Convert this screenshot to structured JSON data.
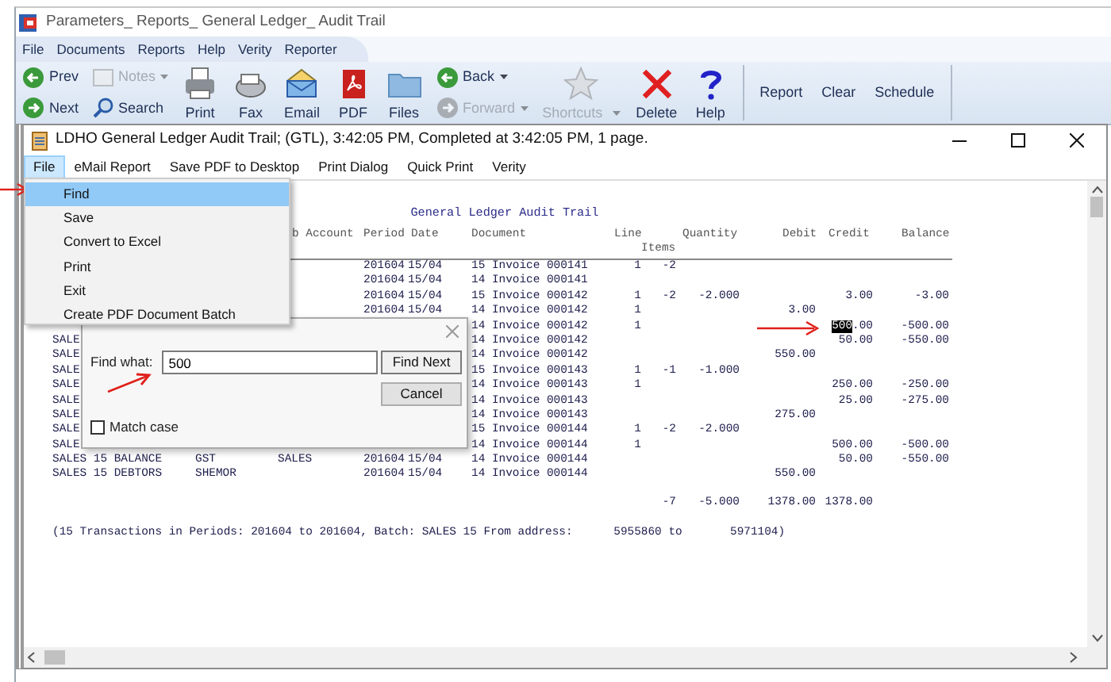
{
  "window": {
    "title": "Parameters_ Reports_ General Ledger_ Audit Trail"
  },
  "menu": [
    "File",
    "Documents",
    "Reports",
    "Help",
    "Verity",
    "Reporter"
  ],
  "toolbar": [
    {
      "kind": "pair",
      "items": [
        {
          "label": "Prev",
          "disabled": false,
          "dropdown": false
        },
        {
          "label": "Next",
          "disabled": false,
          "dropdown": false
        }
      ]
    },
    {
      "kind": "pair",
      "items": [
        {
          "label": "Notes",
          "disabled": true,
          "dropdown": true
        },
        {
          "label": "Search",
          "disabled": false,
          "dropdown": false
        }
      ]
    },
    {
      "kind": "big",
      "label": "Print",
      "disabled": false,
      "dropdown": false
    },
    {
      "kind": "big",
      "label": "Fax",
      "disabled": false,
      "dropdown": false
    },
    {
      "kind": "big",
      "label": "Email",
      "disabled": false,
      "dropdown": false
    },
    {
      "kind": "big",
      "label": "PDF",
      "disabled": false,
      "dropdown": false
    },
    {
      "kind": "big",
      "label": "Files",
      "disabled": false,
      "dropdown": false
    },
    {
      "kind": "pair",
      "items": [
        {
          "label": "Back",
          "disabled": false,
          "dropdown": true
        },
        {
          "label": "Forward",
          "disabled": true,
          "dropdown": true
        }
      ]
    },
    {
      "kind": "big",
      "label": "Shortcuts",
      "disabled": true,
      "dropdown": true
    },
    {
      "kind": "big",
      "label": "Delete",
      "disabled": false,
      "dropdown": false
    },
    {
      "kind": "big",
      "label": "Help",
      "disabled": false,
      "dropdown": false
    },
    {
      "kind": "text",
      "label": "Report"
    },
    {
      "kind": "text",
      "label": "Clear"
    },
    {
      "kind": "text",
      "label": "Schedule"
    }
  ],
  "report_window": {
    "title": "LDHO General Ledger Audit Trail; (GTL), 3:42:05 PM, Completed at 3:42:05 PM, 1 page.",
    "menu": [
      {
        "label": "File",
        "selected": true
      },
      {
        "label": "eMail Report",
        "selected": false
      },
      {
        "label": "Save PDF to Desktop",
        "selected": false
      },
      {
        "label": "Print Dialog",
        "selected": false
      },
      {
        "label": "Quick Print",
        "selected": false
      },
      {
        "label": "Verity",
        "selected": false
      }
    ],
    "report": {
      "title": "General Ledger Audit Trail",
      "columns": [
        "b Account",
        "Period",
        "Date",
        "Document",
        "Line",
        "Items",
        "Quantity",
        "Debit",
        "Credit",
        "Balance"
      ],
      "rows": [
        {
          "period": "201604",
          "date": "15/04",
          "document": "15 Invoice 000141",
          "line": "1",
          "items": "-2"
        },
        {
          "period": "201604",
          "date": "15/04",
          "document": "14 Invoice 000141"
        },
        {
          "period": "201604",
          "date": "15/04",
          "document": "15 Invoice 000142",
          "line": "1",
          "items": "-2",
          "quantity": "-2.000",
          "credit": "3.00",
          "balance": "-3.00"
        },
        {
          "period": "201604",
          "date": "15/04",
          "document": "14 Invoice 000142",
          "line": "1",
          "debit": "3.00"
        },
        {
          "document": "14 Invoice 000142",
          "line": "1",
          "credit_parts": [
            {
              "text": "500",
              "selected": true
            },
            {
              "text": ".00",
              "selected": false
            }
          ],
          "balance": "-500.00"
        },
        {
          "column_1": "SALE",
          "document": "14 Invoice 000142",
          "credit": "50.00",
          "balance": "-550.00"
        },
        {
          "column_1": "SALE",
          "document": "14 Invoice 000142",
          "debit": "550.00"
        },
        {
          "column_1": "SALE",
          "document": "15 Invoice 000143",
          "line": "1",
          "items": "-1",
          "quantity": "-1.000"
        },
        {
          "column_1": "SALE",
          "document": "14 Invoice 000143",
          "line": "1",
          "credit": "250.00",
          "balance": "-250.00"
        },
        {
          "column_1": "SALE",
          "document": "14 Invoice 000143",
          "credit": "25.00",
          "balance": "-275.00"
        },
        {
          "column_1": "SALE",
          "document": "14 Invoice 000143",
          "debit": "275.00"
        },
        {
          "column_1": "SALE",
          "document": "15 Invoice 000144",
          "line": "1",
          "items": "-2",
          "quantity": "-2.000"
        },
        {
          "column_1": "SALE",
          "document": "14 Invoice 000144",
          "line": "1",
          "credit": "500.00",
          "balance": "-500.00"
        },
        {
          "column_1": "SALES 15 BALANCE",
          "account": "GST",
          "column_3": "SALES",
          "period": "201604",
          "date": "15/04",
          "document": "14 Invoice 000144",
          "credit": "50.00",
          "balance": "-550.00"
        },
        {
          "column_1": "SALES 15 DEBTORS",
          "account": "SHEMOR",
          "period": "201604",
          "date": "15/04",
          "document": "14 Invoice 000144",
          "debit": "550.00"
        }
      ],
      "totals": {
        "items": "-7",
        "quantity": "-5.000",
        "debit": "1378.00",
        "credit": "1378.00"
      },
      "summary": "(15 Transactions in Periods: 201604 to 201604, Batch: SALES 15 From address:      5955860 to       5971104)"
    }
  },
  "file_menu": {
    "items": [
      {
        "label": "Find",
        "selected": true
      },
      {
        "label": "Save",
        "selected": false
      },
      {
        "label": "Convert to Excel",
        "selected": false
      },
      {
        "label": "Print",
        "selected": false
      },
      {
        "label": "Exit",
        "selected": false
      },
      {
        "label": "Create PDF Document Batch",
        "selected": false
      }
    ]
  },
  "find_dialog": {
    "label": "Find what:",
    "value": "500",
    "buttons": [
      "Find Next",
      "Cancel"
    ],
    "match_case": {
      "label": "Match case",
      "checked": false
    }
  }
}
